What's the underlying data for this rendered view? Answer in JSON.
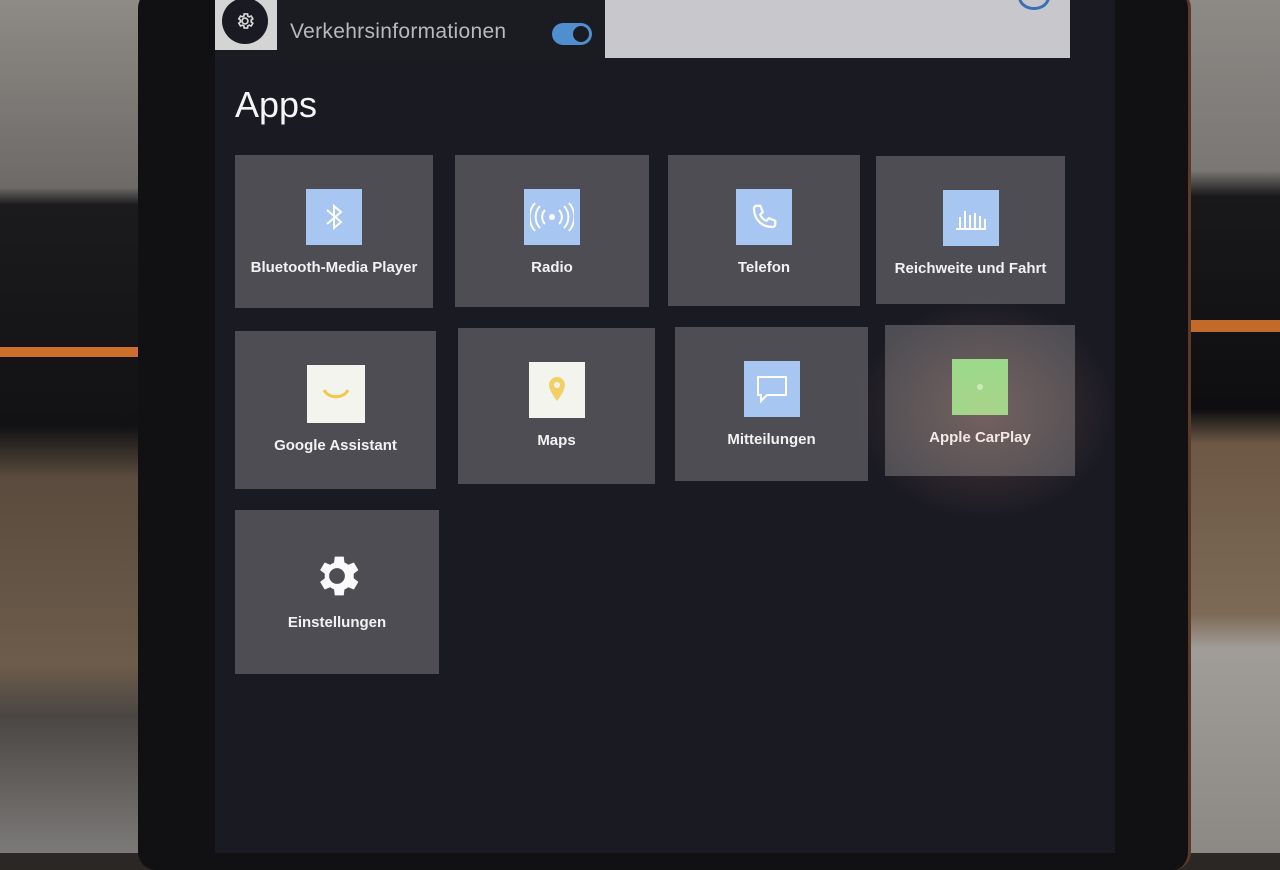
{
  "header": {
    "traffic_label": "Verkehrsinformationen",
    "traffic_toggle_on": true
  },
  "apps": {
    "title": "Apps",
    "items": [
      {
        "label": "Bluetooth-Media Player",
        "icon": "bluetooth-icon"
      },
      {
        "label": "Radio",
        "icon": "radio-icon"
      },
      {
        "label": "Telefon",
        "icon": "phone-icon"
      },
      {
        "label": "Reichweite und Fahrt",
        "icon": "range-chart-icon"
      },
      {
        "label": "Google Assistant",
        "icon": "google-assistant-icon"
      },
      {
        "label": "Maps",
        "icon": "maps-icon"
      },
      {
        "label": "Mitteilungen",
        "icon": "message-icon"
      },
      {
        "label": "Apple CarPlay",
        "icon": "carplay-icon"
      },
      {
        "label": "Einstellungen",
        "icon": "settings-gear-icon"
      }
    ]
  },
  "colors": {
    "screen_bg": "#1a1a23",
    "tile_bg": "#4d4d53",
    "icon_blue": "#a7c6f2",
    "toggle_on": "#4f8fcf"
  }
}
